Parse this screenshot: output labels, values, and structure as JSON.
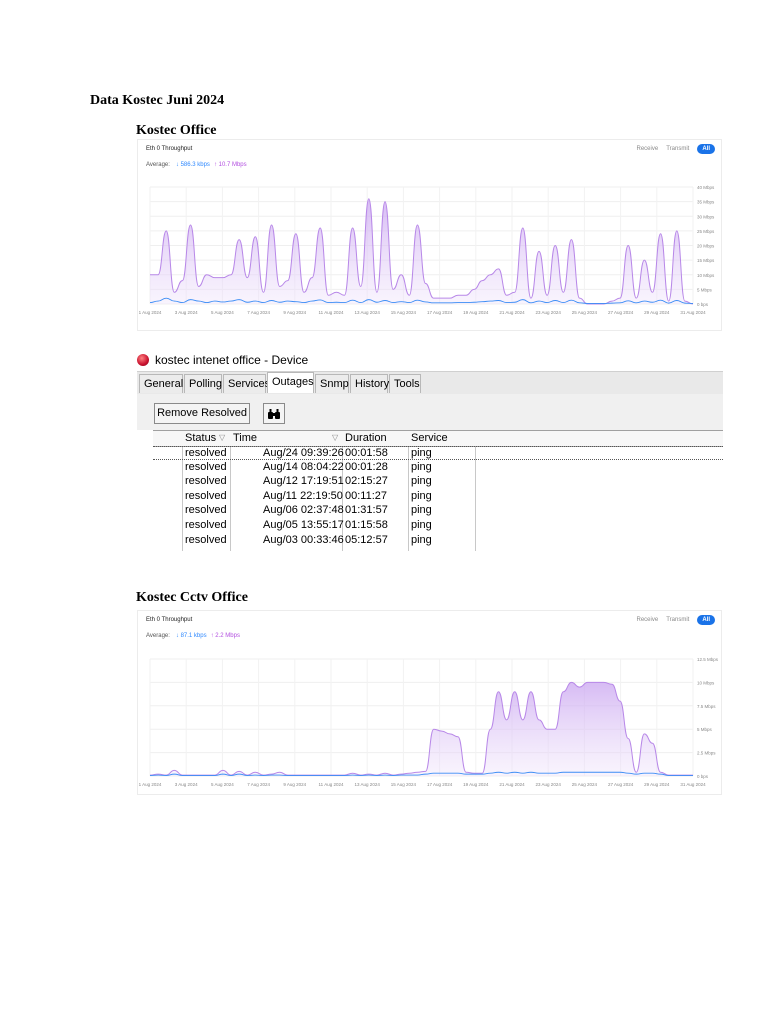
{
  "document": {
    "title": "Data Kostec Juni 2024",
    "section1": "Kostec Office",
    "section2": "Kostec Cctv Office"
  },
  "chart1": {
    "header": "Eth 0 Throughput",
    "avg_label": "Average:",
    "rx": "↓ 586.3 kbps",
    "tx": "↑ 10.7 Mbps",
    "seg_receive": "Receive",
    "seg_transmit": "Transmit",
    "seg_all": "All",
    "rx_color": "#2f89ff",
    "tx_color": "#b24ee0"
  },
  "chart2": {
    "header": "Eth 0 Throughput",
    "avg_label": "Average:",
    "rx": "↓ 87.1 kbps",
    "tx": "↑ 2.2 Mbps",
    "seg_receive": "Receive",
    "seg_transmit": "Transmit",
    "seg_all": "All"
  },
  "chart_data": [
    {
      "type": "area",
      "title": "Eth 0 Throughput",
      "ylim": [
        0,
        40
      ],
      "yunit": "Mbps",
      "yticks": [
        "40 Mbps",
        "35 Mbps",
        "30 Mbps",
        "25 Mbps",
        "20 Mbps",
        "15 Mbps",
        "10 Mbps",
        "5 Mbps",
        "0 bps"
      ],
      "xticks": [
        "1 Aug 2024",
        "3 Aug 2024",
        "5 Aug 2024",
        "7 Aug 2024",
        "9 Aug 2024",
        "11 Aug 2024",
        "13 Aug 2024",
        "15 Aug 2024",
        "17 Aug 2024",
        "19 Aug 2024",
        "21 Aug 2024",
        "23 Aug 2024",
        "25 Aug 2024",
        "27 Aug 2024",
        "29 Aug 2024",
        "31 Aug 2024"
      ],
      "series": [
        {
          "name": "Transmit",
          "values": [
            10,
            10,
            25,
            4,
            8,
            27,
            6,
            10,
            9,
            9,
            10,
            22,
            9,
            23,
            4,
            27,
            6,
            8,
            24,
            4,
            9,
            26,
            3,
            4,
            3,
            26,
            6,
            36,
            4,
            35,
            5,
            10,
            3,
            27,
            7,
            2,
            2,
            2,
            3,
            3,
            5,
            8,
            10,
            12,
            3,
            4,
            26,
            2,
            18,
            3,
            20,
            4,
            22,
            2,
            0,
            0,
            0,
            1,
            2,
            20,
            2,
            15,
            4,
            24,
            1,
            25,
            1,
            0
          ]
        },
        {
          "name": "Receive",
          "values": [
            0.5,
            1,
            2,
            1,
            0.5,
            1.5,
            1,
            0.5,
            1,
            0.7,
            1,
            1.5,
            0.6,
            1,
            0.5,
            1.2,
            0.6,
            1,
            0.8,
            0.5,
            1,
            1.4,
            0.5,
            0.6,
            0.5,
            1.3,
            0.5,
            1.5,
            0.6,
            1.2,
            0.5,
            0.8,
            0.5,
            1.3,
            0.7,
            0.4,
            0.4,
            0.4,
            0.5,
            0.5,
            0.6,
            0.8,
            1,
            1.2,
            0.5,
            0.6,
            1.5,
            0.4,
            1,
            0.5,
            1.2,
            0.5,
            1.3,
            0.4,
            0.2,
            0.2,
            0.2,
            0.3,
            0.4,
            1.1,
            0.4,
            1,
            0.6,
            1.3,
            0.3,
            1.2,
            0.3,
            0.2
          ]
        }
      ]
    },
    {
      "type": "area",
      "title": "Eth 0 Throughput",
      "ylim": [
        0,
        12.5
      ],
      "yunit": "Mbps",
      "yticks": [
        "12.5 Mbps",
        "10 Mbps",
        "7.5 Mbps",
        "5 Mbps",
        "2.5 Mbps",
        "0 bps"
      ],
      "xticks": [
        "1 Aug 2024",
        "3 Aug 2024",
        "5 Aug 2024",
        "7 Aug 2024",
        "9 Aug 2024",
        "11 Aug 2024",
        "13 Aug 2024",
        "15 Aug 2024",
        "17 Aug 2024",
        "19 Aug 2024",
        "21 Aug 2024",
        "23 Aug 2024",
        "25 Aug 2024",
        "27 Aug 2024",
        "29 Aug 2024",
        "31 Aug 2024"
      ],
      "series": [
        {
          "name": "Transmit",
          "values": [
            0.1,
            0.2,
            0.1,
            0.6,
            0.1,
            0.1,
            0.1,
            0.1,
            0.1,
            0.6,
            0.1,
            0.5,
            0.1,
            0.4,
            0.1,
            0.2,
            0.4,
            0.1,
            0.1,
            0.1,
            0.1,
            0.1,
            0.1,
            0.1,
            0.1,
            0.3,
            0.1,
            0.2,
            0.1,
            0.3,
            0.1,
            0.2,
            0.3,
            0.4,
            0.5,
            5,
            4.8,
            4.5,
            4.2,
            0.4,
            0.3,
            0.3,
            5,
            9,
            6,
            9,
            6,
            9,
            6,
            5,
            5,
            9,
            10,
            9.5,
            10,
            10,
            10,
            9.8,
            8,
            4,
            0.4,
            4.5,
            3.5,
            0.4,
            0.1,
            0.1,
            0.1,
            0.1
          ]
        },
        {
          "name": "Receive",
          "values": [
            0.05,
            0.1,
            0.05,
            0.2,
            0.05,
            0.05,
            0.05,
            0.05,
            0.05,
            0.2,
            0.05,
            0.2,
            0.05,
            0.1,
            0.05,
            0.1,
            0.1,
            0.05,
            0.05,
            0.05,
            0.05,
            0.05,
            0.05,
            0.05,
            0.05,
            0.1,
            0.05,
            0.1,
            0.05,
            0.1,
            0.05,
            0.1,
            0.1,
            0.1,
            0.2,
            0.3,
            0.3,
            0.3,
            0.3,
            0.2,
            0.2,
            0.2,
            0.3,
            0.4,
            0.3,
            0.4,
            0.3,
            0.4,
            0.3,
            0.3,
            0.3,
            0.4,
            0.4,
            0.4,
            0.4,
            0.4,
            0.4,
            0.4,
            0.4,
            0.3,
            0.2,
            0.3,
            0.3,
            0.2,
            0.05,
            0.05,
            0.05,
            0.05
          ]
        }
      ]
    }
  ],
  "window": {
    "title": "kostec intenet office - Device",
    "tabs": [
      "General",
      "Polling",
      "Services",
      "Outages",
      "Snmp",
      "History",
      "Tools"
    ],
    "active_tab": "Outages",
    "remove_btn": "Remove Resolved",
    "columns": [
      "Status",
      "Time",
      "Duration",
      "Service"
    ],
    "rows": [
      [
        "resolved",
        "Aug/24 09:39:26",
        "00:01:58",
        "ping"
      ],
      [
        "resolved",
        "Aug/14 08:04:22",
        "00:01:28",
        "ping"
      ],
      [
        "resolved",
        "Aug/12 17:19:51",
        "02:15:27",
        "ping"
      ],
      [
        "resolved",
        "Aug/11 22:19:50",
        "00:11:27",
        "ping"
      ],
      [
        "resolved",
        "Aug/06 02:37:48",
        "01:31:57",
        "ping"
      ],
      [
        "resolved",
        "Aug/05 13:55:17",
        "01:15:58",
        "ping"
      ],
      [
        "resolved",
        "Aug/03 00:33:46",
        "05:12:57",
        "ping"
      ]
    ]
  }
}
